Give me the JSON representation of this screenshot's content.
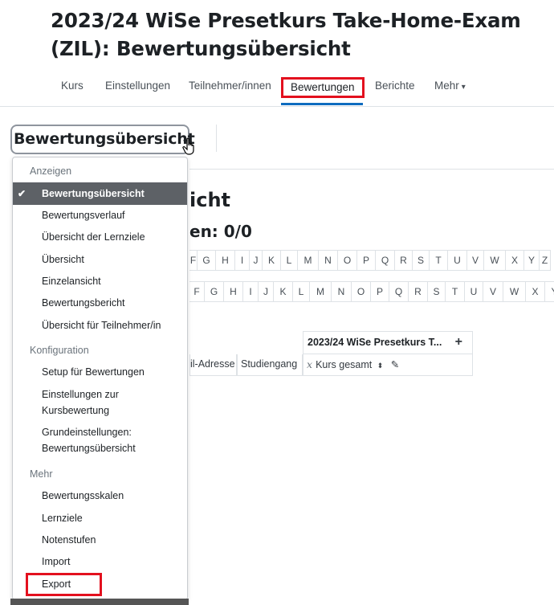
{
  "page": {
    "title": "2023/24 WiSe Presetkurs Take-Home-Exam (ZIL): Bewertungsübersicht"
  },
  "nav": {
    "items": [
      {
        "label": "Kurs"
      },
      {
        "label": "Einstellungen"
      },
      {
        "label": "Teilnehmer/innen"
      },
      {
        "label": "Bewertungen"
      },
      {
        "label": "Berichte"
      },
      {
        "label": "Mehr"
      }
    ]
  },
  "selector": {
    "label": "Bewertungsübersicht"
  },
  "background": {
    "heading": "icht",
    "subheading": "en: 0/0",
    "letters_row1": [
      "F",
      "G",
      "H",
      "I",
      "J",
      "K",
      "L",
      "M",
      "N",
      "O",
      "P",
      "Q",
      "R",
      "S",
      "T",
      "U",
      "V",
      "W",
      "X",
      "Y",
      "Z"
    ],
    "letters_row2": [
      "F",
      "G",
      "H",
      "I",
      "J",
      "K",
      "L",
      "M",
      "N",
      "O",
      "P",
      "Q",
      "R",
      "S",
      "T",
      "U",
      "V",
      "W",
      "X",
      "Y"
    ],
    "table": {
      "course_header": "2023/24 WiSe Presetkurs T...",
      "col_email": "il-Adresse",
      "col_study": "Studiengang",
      "col_total": "Kurs gesamt"
    }
  },
  "dropdown": {
    "sections": [
      {
        "header": "Anzeigen",
        "items": [
          {
            "label": "Bewertungsübersicht",
            "selected": true
          },
          {
            "label": "Bewertungsverlauf"
          },
          {
            "label": "Übersicht der Lernziele"
          },
          {
            "label": "Übersicht"
          },
          {
            "label": "Einzelansicht"
          },
          {
            "label": "Bewertungsbericht"
          },
          {
            "label": "Übersicht für Teilnehmer/in"
          }
        ]
      },
      {
        "header": "Konfiguration",
        "items": [
          {
            "label": "Setup für Bewertungen"
          },
          {
            "label": "Einstellungen zur Kursbewertung"
          },
          {
            "label": "Grundeinstellungen: Bewertungsübersicht"
          }
        ]
      },
      {
        "header": "Mehr",
        "items": [
          {
            "label": "Bewertungsskalen"
          },
          {
            "label": "Lernziele"
          },
          {
            "label": "Notenstufen"
          },
          {
            "label": "Import"
          },
          {
            "label": "Export"
          }
        ]
      }
    ]
  },
  "colors": {
    "highlight_red": "#e3101e",
    "accent_blue": "#0f6cbf",
    "selected_bg": "#5d6166"
  }
}
